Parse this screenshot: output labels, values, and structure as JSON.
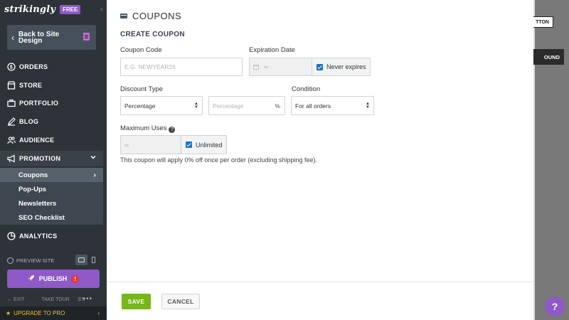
{
  "sidebar": {
    "logo": "strikingly",
    "plan_badge": "FREE",
    "back_button": "Back to Site Design",
    "nav": {
      "orders": "ORDERS",
      "store": "STORE",
      "portfolio": "PORTFOLIO",
      "blog": "BLOG",
      "audience": "AUDIENCE",
      "promotion": "PROMOTION",
      "analytics": "ANALYTICS"
    },
    "promotion_sub": {
      "coupons": "Coupons",
      "popups": "Pop-Ups",
      "newsletters": "Newsletters",
      "seo": "SEO Checklist"
    },
    "preview_site": "PREVIEW SITE",
    "publish": "PUBLISH",
    "publish_alert": "!",
    "exit": "EXIT",
    "take_tour": "TAKE TOUR",
    "language": "EN",
    "more": "•••",
    "upgrade": "UPGRADE TO PRO"
  },
  "background_page": {
    "button1": "TTON",
    "button2": "OUND"
  },
  "panel": {
    "title": "COUPONS",
    "section_title": "CREATE COUPON",
    "coupon_code": {
      "label": "Coupon Code",
      "placeholder": "E.G. NEWYEAR26"
    },
    "expiration_date": {
      "label": "Expiration Date",
      "value": "∞",
      "never_expires": "Never expires",
      "never_expires_checked": true
    },
    "discount_type": {
      "label": "Discount Type",
      "selected": "Percentage"
    },
    "discount_value": {
      "placeholder": "Percentage",
      "unit": "%"
    },
    "condition": {
      "label": "Condition",
      "selected": "For all orders"
    },
    "maximum_uses": {
      "label": "Maximum Uses",
      "value": "∞",
      "unlimited": "Unlimited",
      "unlimited_checked": true
    },
    "note": "This coupon will apply 0% off once per order (excluding shipping fee).",
    "save": "SAVE",
    "cancel": "CANCEL"
  },
  "help": "?",
  "colors": {
    "sidebar_bg": "#2d3338",
    "brand_purple": "#8e59c8",
    "save_green": "#78b51e",
    "checkbox_blue": "#1e73be",
    "upgrade_yellow": "#f2c230"
  }
}
